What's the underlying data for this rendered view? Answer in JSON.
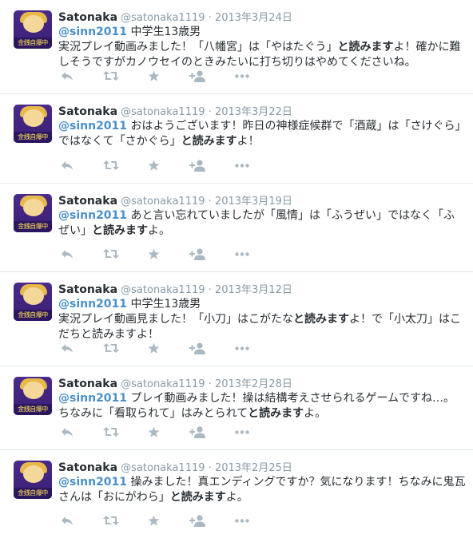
{
  "colors": {
    "mention": "#4a90c8",
    "meta": "#8899a6",
    "text": "#292f33",
    "action_icon": "#aab8c2",
    "avatar_bg": "#3a1f72",
    "divider": "#e1e8ed"
  },
  "avatar_text": "金銭自爆中",
  "tweets": [
    {
      "name": "Satonaka",
      "handle": "@satonaka1119",
      "sep": "·",
      "date": "2013年3月24日",
      "mention": "@sinn2011",
      "parts": [
        " 中学生13歳男\n実況プレイ動画みました！「八幡宮」は「やはたぐう」",
        "と読みます",
        "よ！確かに難しそうですがカノウセイのときみたいに打ち切りはやめてくださいね。"
      ]
    },
    {
      "name": "Satonaka",
      "handle": "@satonaka1119",
      "sep": "·",
      "date": "2013年3月22日",
      "mention": "@sinn2011",
      "parts": [
        " おはようございます！昨日の神様症候群で「酒蔵」は「さけぐら」ではなくて「さかぐら」",
        "と読みます",
        "よ！"
      ]
    },
    {
      "name": "Satonaka",
      "handle": "@satonaka1119",
      "sep": "·",
      "date": "2013年3月19日",
      "mention": "@sinn2011",
      "parts": [
        " あと言い忘れていましたが「風情」は「ふうぜい」ではなく「ふぜい」",
        "と読みます",
        "よ。"
      ]
    },
    {
      "name": "Satonaka",
      "handle": "@satonaka1119",
      "sep": "·",
      "date": "2013年3月12日",
      "mention": "@sinn2011",
      "parts": [
        " 中学生13歳男\n実況プレイ動画見ました！「小刀」はこがたな",
        "と読みます",
        "よ！で「小太刀」はこだちと読みますよ！"
      ]
    },
    {
      "name": "Satonaka",
      "handle": "@satonaka1119",
      "sep": "·",
      "date": "2013年2月28日",
      "mention": "@sinn2011",
      "parts": [
        " プレイ動画みました！操は結構考えさせられるゲームですね…。ちなみに「看取られて」はみとられて",
        "と読みます",
        "よ。"
      ]
    },
    {
      "name": "Satonaka",
      "handle": "@satonaka1119",
      "sep": "·",
      "date": "2013年2月25日",
      "mention": "@sinn2011",
      "parts": [
        " 操みました！真エンディングですか？気になります！ちなみに鬼瓦さんは「おにがわら」",
        "と読みます",
        "よ。"
      ]
    }
  ],
  "actions": [
    "reply-icon",
    "retweet-icon",
    "favorite-icon",
    "follow-icon",
    "more-icon"
  ]
}
